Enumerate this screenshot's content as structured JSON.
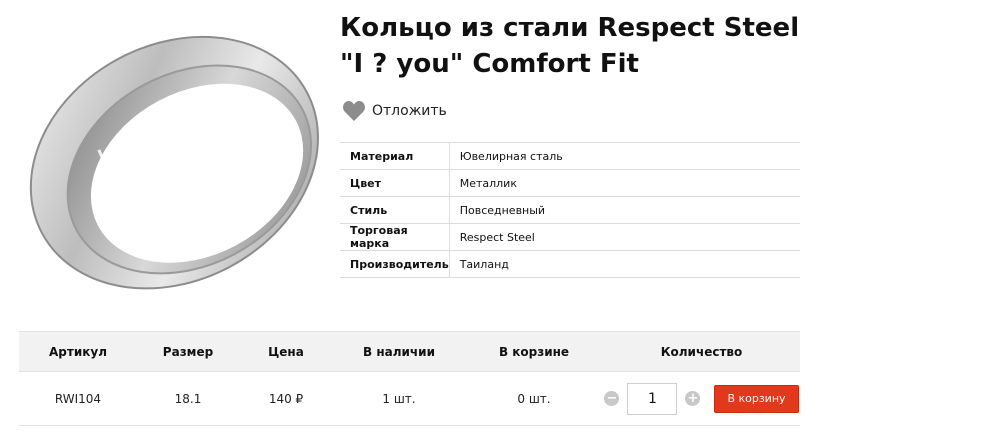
{
  "product": {
    "title": "Кольцо из стали Respect Steel \"I ? you\" Comfort Fit",
    "image_engraving": "I ♥ YOU"
  },
  "wishlist": {
    "label": "Отложить",
    "icon": "heart-icon"
  },
  "specs": [
    {
      "key": "Материал",
      "value": "Ювелирная сталь"
    },
    {
      "key": "Цвет",
      "value": "Металлик"
    },
    {
      "key": "Стиль",
      "value": "Повседневный"
    },
    {
      "key": "Торговая марка",
      "value": "Respect Steel"
    },
    {
      "key": "Производитель",
      "value": "Таиланд"
    }
  ],
  "offers": {
    "headers": [
      "Артикул",
      "Размер",
      "Цена",
      "В наличии",
      "В корзине",
      "Количество"
    ],
    "row": {
      "sku": "RWI104",
      "size": "18.1",
      "price": "140 ₽",
      "in_stock": "1 шт.",
      "in_cart": "0 шт.",
      "quantity": "1"
    },
    "minus_label": "−",
    "plus_label": "+",
    "add_to_cart": "В корзину"
  },
  "colors": {
    "accent": "#e2381b",
    "border": "#dcdcdc",
    "header_bg": "#f2f2f2"
  }
}
